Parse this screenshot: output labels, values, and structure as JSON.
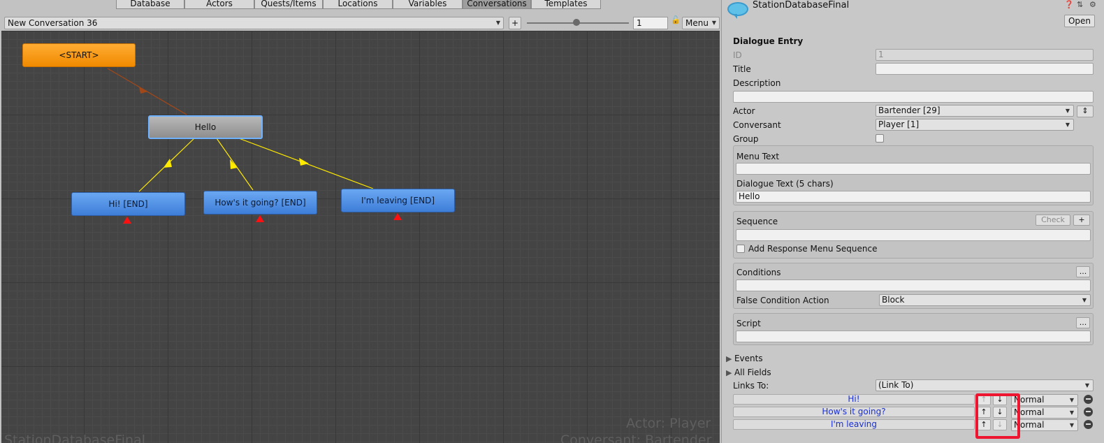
{
  "tabs": [
    "Database",
    "Actors",
    "Quests/Items",
    "Locations",
    "Variables",
    "Conversations",
    "Templates"
  ],
  "toolbar": {
    "conversation": "New Conversation 36",
    "add": "+",
    "zoom": "1",
    "menu": "Menu"
  },
  "nodes": {
    "start": "<START>",
    "hello": "Hello",
    "hi": "Hi! [END]",
    "going": "How's it going? [END]",
    "leaving": "I'm leaving [END]"
  },
  "overlay": {
    "actor": "Actor: Player",
    "database": "StationDatabaseFinal",
    "conversant": "Conversant: Bartender"
  },
  "inspector": {
    "db_name": "StationDatabaseFinal",
    "open": "Open",
    "section": "Dialogue Entry",
    "id_label": "ID",
    "id_value": "1",
    "title_label": "Title",
    "title_value": "",
    "description_label": "Description",
    "description_value": "",
    "actor_label": "Actor",
    "actor_value": "Bartender [29]",
    "conversant_label": "Conversant",
    "conversant_value": "Player [1]",
    "group_label": "Group",
    "menu_text_label": "Menu Text",
    "menu_text_value": "",
    "dialogue_text_label": "Dialogue Text (5 chars)",
    "dialogue_text_value": "Hello",
    "sequence_label": "Sequence",
    "check": "Check",
    "plus": "+",
    "sequence_value": "",
    "add_response_label": "Add Response Menu Sequence",
    "conditions_label": "Conditions",
    "ellipsis": "...",
    "conditions_value": "",
    "false_action_label": "False Condition Action",
    "false_action_value": "Block",
    "script_label": "Script",
    "script_value": "",
    "events_label": "Events",
    "all_fields_label": "All Fields",
    "links_label": "Links To:",
    "links_value": "(Link To)",
    "links": [
      {
        "text": "Hi!",
        "priority": "Normal"
      },
      {
        "text": "How's it going?",
        "priority": "Normal"
      },
      {
        "text": "I'm leaving",
        "priority": "Normal"
      }
    ]
  },
  "colors": {
    "start": "#f5960f",
    "npc": "#a8a8a8",
    "pc": "#4a8ae0",
    "link": "#ffea00",
    "highlight": "#ee1530"
  }
}
